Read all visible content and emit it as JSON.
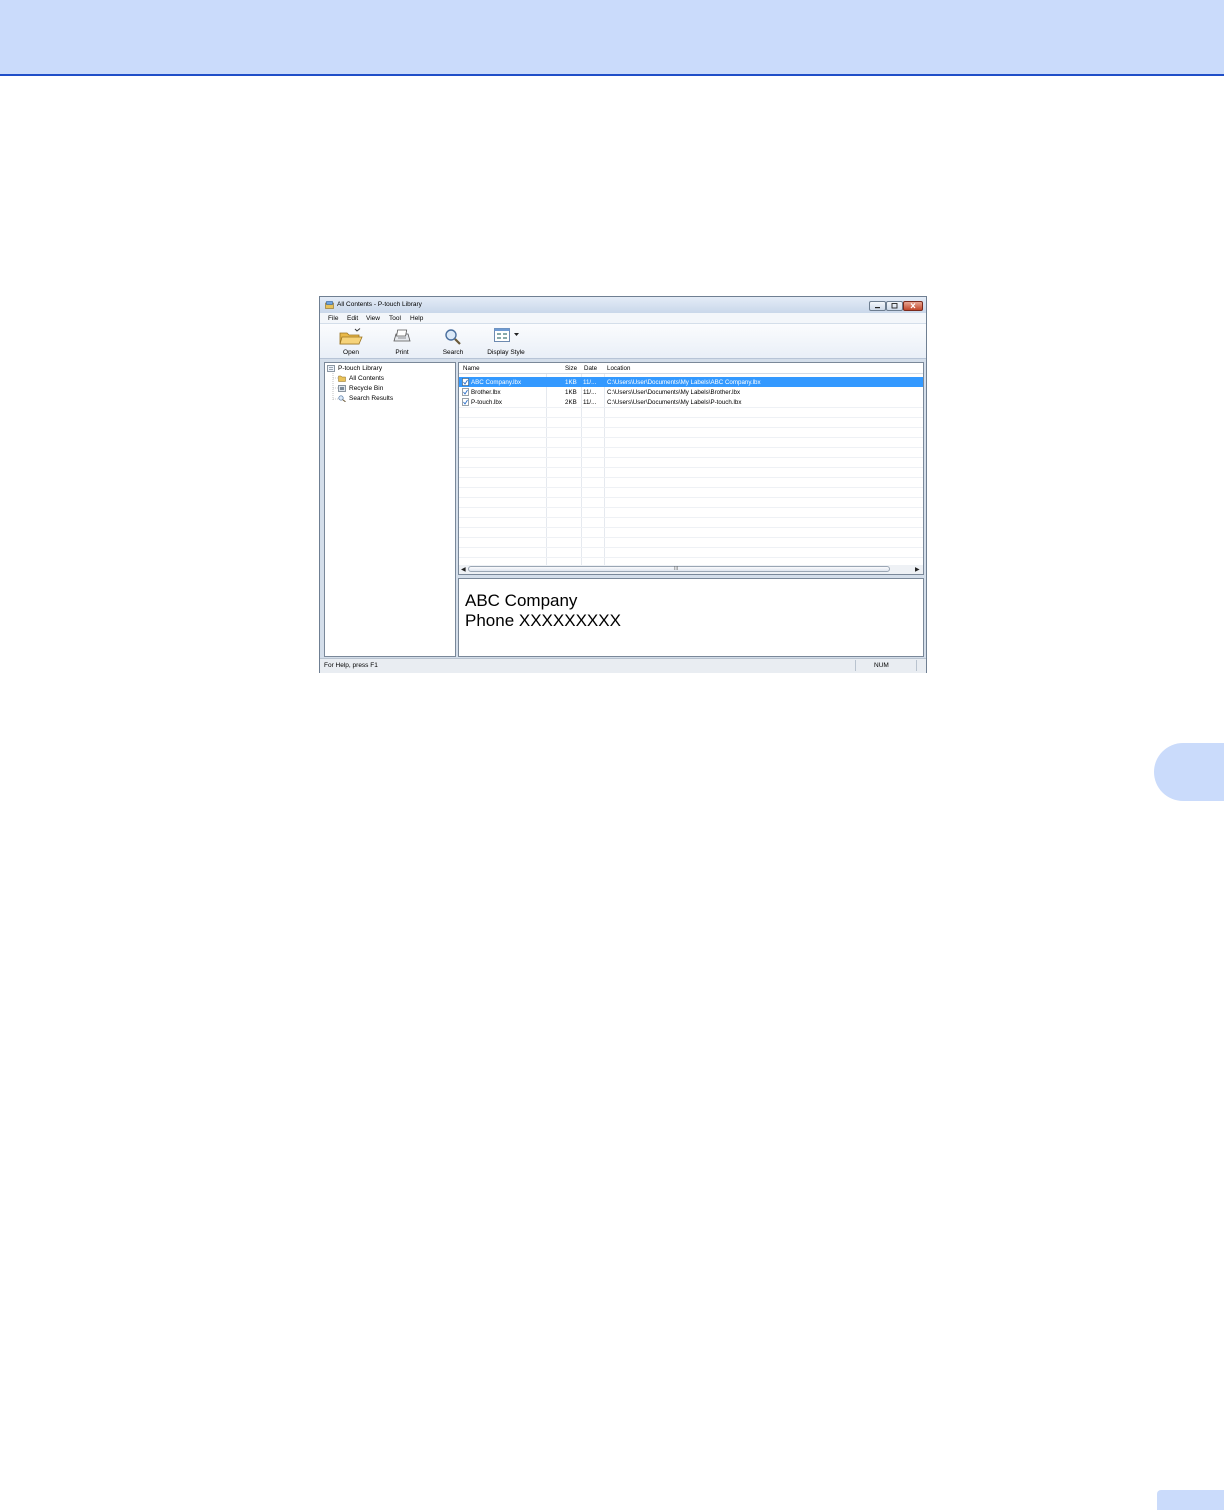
{
  "window": {
    "title": "All Contents - P-touch Library"
  },
  "menu": [
    "File",
    "Edit",
    "View",
    "Tool",
    "Help"
  ],
  "toolbar": {
    "open_label": "Open",
    "print_label": "Print",
    "search_label": "Search",
    "display_style_label": "Display Style"
  },
  "tree": {
    "root": "P-touch Library",
    "items": [
      "All Contents",
      "Recycle Bin",
      "Search Results"
    ]
  },
  "list": {
    "columns": [
      "Name",
      "Size",
      "Date",
      "Location"
    ],
    "rows": [
      {
        "name": "ABC Company.lbx",
        "size": "1KB",
        "date": "11/...",
        "location": "C:\\Users\\User\\Documents\\My Labels\\ABC Company.lbx",
        "selected": true
      },
      {
        "name": "Brother.lbx",
        "size": "1KB",
        "date": "11/...",
        "location": "C:\\Users\\User\\Documents\\My Labels\\Brother.lbx",
        "selected": false
      },
      {
        "name": "P-touch.lbx",
        "size": "2KB",
        "date": "11/...",
        "location": "C:\\Users\\User\\Documents\\My Labels\\P-touch.lbx",
        "selected": false
      }
    ],
    "scroll_grip": "III"
  },
  "preview": {
    "line1": "ABC Company",
    "line2": "Phone XXXXXXXXX"
  },
  "status": {
    "help_text": "For Help, press F1",
    "num_indicator": "NUM"
  },
  "colors": {
    "header_band": "#cadbfb",
    "header_rule": "#1f4ec8",
    "selection": "#3399ff"
  }
}
